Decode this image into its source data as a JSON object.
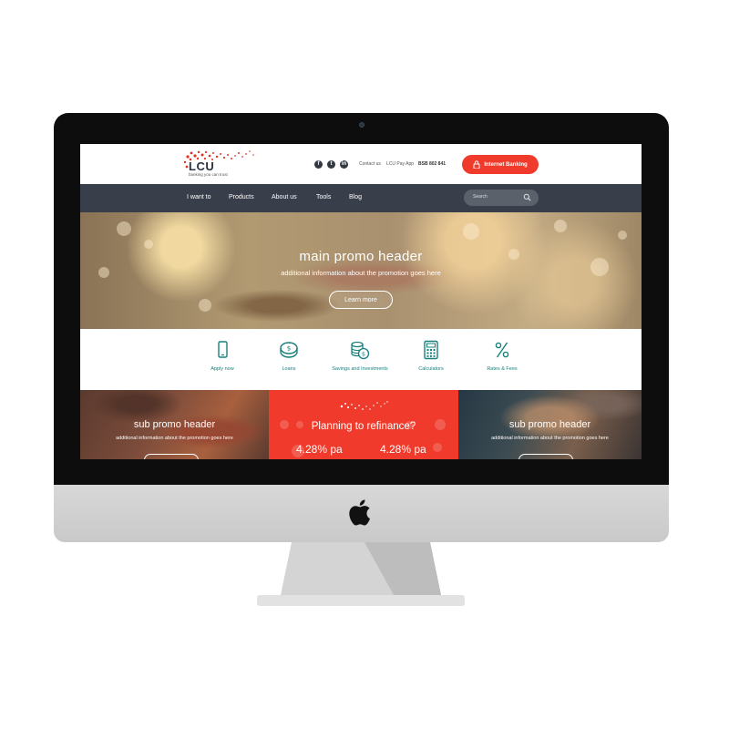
{
  "header": {
    "logo_text": "LCU",
    "logo_tagline": "banking you can trust",
    "social": [
      "facebook-icon",
      "twitter-icon",
      "linkedin-icon"
    ],
    "contact_label": "Contact us",
    "pay_app_label": "LCU Pay App",
    "bsb": "BSB  802 841",
    "internet_banking_label": "Internet Banking"
  },
  "nav": {
    "items": [
      "I want to",
      "Products",
      "About us",
      "Tools",
      "Blog"
    ],
    "search_placeholder": "Search"
  },
  "hero": {
    "title": "main  promo header",
    "subtitle": "additional information about the promotion goes here",
    "button_label": "Learn more"
  },
  "quick_links": [
    {
      "label": "Apply now",
      "icon": "phone-icon"
    },
    {
      "label": "Loans",
      "icon": "coin-icon"
    },
    {
      "label": "Savings and Investments",
      "icon": "coin-stack-icon"
    },
    {
      "label": "Calculators",
      "icon": "calculator-icon"
    },
    {
      "label": "Rates & Fees",
      "icon": "percent-icon"
    }
  ],
  "promos": {
    "left": {
      "title": "sub promo header",
      "subtitle": "additional information about the promotion goes here"
    },
    "middle": {
      "title": "Planning to refinance?",
      "rate_1": "4.28% pa",
      "rate_2": "4.28% pa"
    },
    "right": {
      "title": "sub promo header",
      "subtitle": "additional information about the promotion goes here"
    }
  },
  "colors": {
    "accent_red": "#ef3a2c",
    "nav_dark": "#383f4a",
    "teal": "#17807d"
  }
}
